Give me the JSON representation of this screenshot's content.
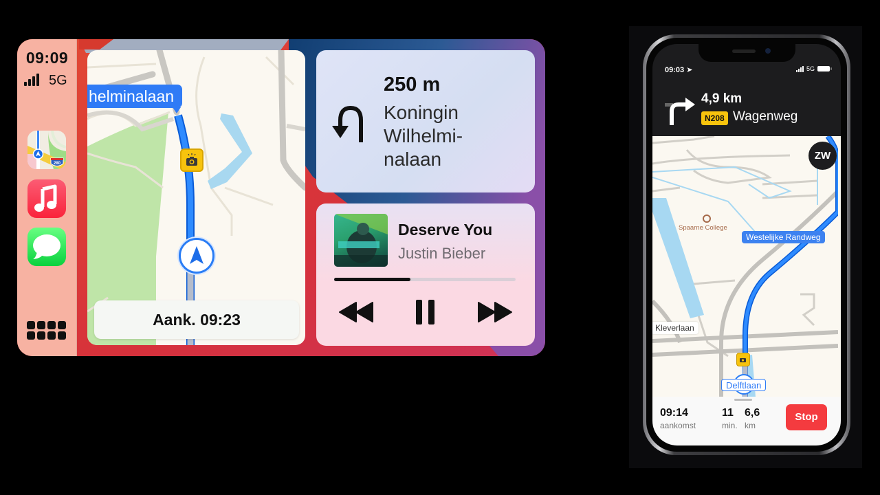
{
  "carplay": {
    "dock": {
      "time": "09:09",
      "network": "5G",
      "signal_bars": 4,
      "apps": [
        {
          "name": "Maps",
          "icon": "maps-app-icon",
          "badge_text": "280"
        },
        {
          "name": "Music",
          "icon": "music-app-icon"
        },
        {
          "name": "Messages",
          "icon": "messages-app-icon"
        }
      ],
      "app_library_icon": "grid-icon"
    },
    "map": {
      "street_label": "helminalaan",
      "speed_camera_icon": "camera-icon",
      "location_icon": "navigation-arrow-icon",
      "eta_label": "Aank. 09:23"
    },
    "guidance": {
      "maneuver_icon": "u-turn-left-icon",
      "distance": "250 m",
      "street_lines": [
        "Koningin",
        "Wilhelmi-",
        "nalaan"
      ]
    },
    "now_playing": {
      "title": "Deserve You",
      "artist": "Justin Bieber",
      "album_art_icon": "album-art",
      "progress": 0.42,
      "controls": {
        "previous": "rewind-icon",
        "pause": "pause-icon",
        "next": "fast-forward-icon"
      }
    },
    "colors": {
      "dock_bg": "#f7b2a2",
      "route_blue": "#1a7cf5",
      "label_blue": "#2f7bf6",
      "camera_yellow": "#f7c30d"
    }
  },
  "iphone": {
    "status_bar": {
      "time": "09:03",
      "location_icon": "location-arrow-icon",
      "network": "5G"
    },
    "guidance": {
      "maneuver_icon": "turn-right-icon",
      "distance": "4,9 km",
      "road_number": "N208",
      "street": "Wagenweg"
    },
    "map": {
      "compass_label": "ZW",
      "labels": {
        "poi": "Spaarne College",
        "road_1": "Westelijke Randweg",
        "road_2": "Kleverlaan",
        "current_road": "Delftlaan"
      }
    },
    "trip": {
      "arrival_time": "09:14",
      "arrival_label": "aankomst",
      "minutes": "11",
      "minutes_label": "min.",
      "distance": "6,6",
      "distance_label": "km",
      "stop_label": "Stop"
    },
    "colors": {
      "stop_red": "#f43b3f",
      "badge_yellow": "#f7c30d"
    }
  }
}
